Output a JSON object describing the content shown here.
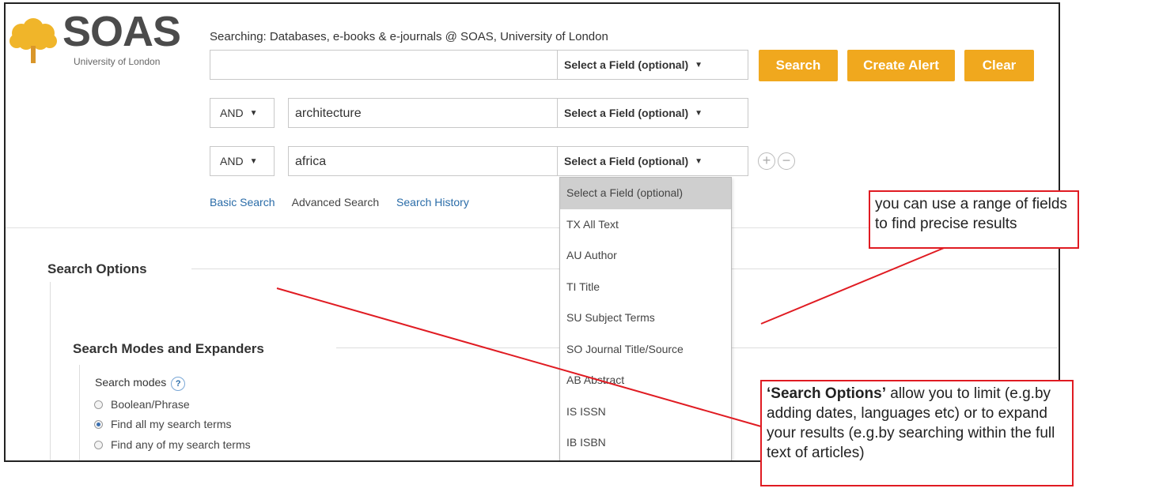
{
  "header": {
    "logo_text": "SOAS",
    "logo_subtitle": "University of London",
    "searching_label": "Searching: Databases, e-books & e-journals @ SOAS, University of London"
  },
  "search_rows": [
    {
      "operator": "",
      "value": "",
      "field": "Select a Field (optional)"
    },
    {
      "operator": "AND",
      "value": "architecture",
      "field": "Select a Field (optional)"
    },
    {
      "operator": "AND",
      "value": "africa",
      "field": "Select a Field (optional)"
    }
  ],
  "buttons": {
    "search": "Search",
    "create_alert": "Create Alert",
    "clear": "Clear",
    "add": "+",
    "remove": "−"
  },
  "nav_links": {
    "basic": "Basic Search",
    "advanced": "Advanced Search",
    "history": "Search History"
  },
  "field_dropdown": {
    "selected": "Select a Field (optional)",
    "options": [
      "Select a Field (optional)",
      "TX All Text",
      "AU Author",
      "TI Title",
      "SU Subject Terms",
      "SO Journal Title/Source",
      "AB Abstract",
      "IS ISSN",
      "IB ISBN"
    ]
  },
  "search_options": {
    "title": "Search Options",
    "modes_section_title": "Search Modes and Expanders",
    "modes_label": "Search modes",
    "help": "?",
    "modes": [
      {
        "label": "Boolean/Phrase",
        "checked": false
      },
      {
        "label": "Find all my search terms",
        "checked": true
      },
      {
        "label": "Find any of my search terms",
        "checked": false
      }
    ]
  },
  "annotations": {
    "fields_note": "you can use a range of fields to find precise results",
    "options_note_bold": "‘Search Options’",
    "options_note_rest": " allow you to limit (e.g.by adding dates, languages etc) or to expand your results (e.g.by searching within the full text of articles)",
    "color": "#e01b22"
  },
  "colors": {
    "accent": "#f0a81e",
    "link": "#2a6ca8"
  }
}
